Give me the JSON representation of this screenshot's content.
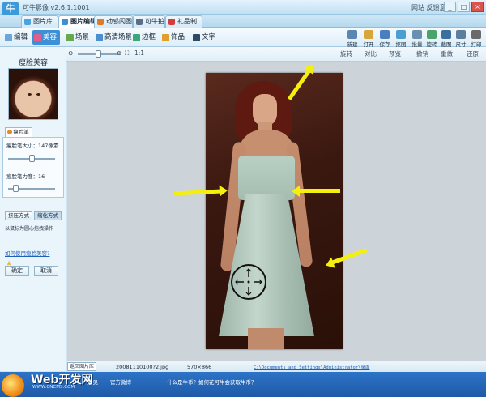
{
  "app": {
    "logo": "牛",
    "title": "可牛影像 v2.6.1.1001",
    "links": "网站  反馈意见",
    "win_min": "_",
    "win_max": "□",
    "win_close": "×"
  },
  "tabs": [
    {
      "label": "图片库",
      "color": "#4aa3e0"
    },
    {
      "label": "图片编辑",
      "color": "#3b8fd2",
      "active": true
    },
    {
      "label": "动感闪图",
      "color": "#e07a2b"
    },
    {
      "label": "可牛拍照",
      "color": "#5a6f86"
    },
    {
      "label": "礼品制作",
      "color": "#d63b3b"
    }
  ],
  "toolbar": {
    "left": [
      {
        "label": "编辑",
        "icon": "edit-icon",
        "color": "#6aa7d8"
      },
      {
        "label": "美容",
        "icon": "beauty-icon",
        "color": "#e05f8c",
        "active": true
      },
      {
        "label": "场景",
        "icon": "scene-icon",
        "color": "#66a84b"
      },
      {
        "label": "高清场景",
        "icon": "hd-scene-icon",
        "color": "#4b8fd0"
      },
      {
        "label": "边框",
        "icon": "frame-icon",
        "color": "#3aa879"
      },
      {
        "label": "饰品",
        "icon": "accessory-icon",
        "color": "#e0a02b"
      },
      {
        "label": "文字",
        "icon": "text-icon",
        "color": "#2f4a66"
      }
    ],
    "right": [
      {
        "label": "新建",
        "icon": "new-icon",
        "color": "#5a87b0"
      },
      {
        "label": "打开",
        "icon": "open-icon",
        "color": "#d9a53a"
      },
      {
        "label": "保存",
        "icon": "save-icon",
        "color": "#4a7fbf"
      },
      {
        "label": "抠图",
        "icon": "cutout-icon",
        "color": "#4a9fd0"
      },
      {
        "label": "批量",
        "icon": "batch-icon",
        "color": "#6a8fb0"
      },
      {
        "label": "旋转",
        "icon": "rotate-icon",
        "color": "#4aa36a"
      },
      {
        "label": "截图",
        "icon": "screenshot-icon",
        "color": "#3a6fa0"
      },
      {
        "label": "尺寸",
        "icon": "size-icon",
        "color": "#5a7f9f"
      },
      {
        "label": "打印",
        "icon": "print-icon",
        "color": "#6a6a6a"
      }
    ]
  },
  "viewbar": {
    "ratio": "1:1",
    "items": [
      "旋转",
      "对比",
      "预览",
      "撤销",
      "重做",
      "还原"
    ]
  },
  "side": {
    "title": "瘦脸美容",
    "subtab": "瘦脸笔",
    "size_label": "瘦脸笔大小：147像素",
    "size_level": 0.5,
    "strength_label": "瘦脸笔力度：16",
    "strength_level": 0.16,
    "mode_push": "挤压方式",
    "mode_shrink": "缩化方式",
    "note": "以鼠标为圆心拖拽操作",
    "help": "如何使用瘦脸美容?",
    "ok": "确定",
    "cancel": "取消"
  },
  "status": {
    "button": "返回图片库",
    "filename": "20081110100?2.jpg",
    "dims": "570×866",
    "path": "C:\\Documents and Settings\\Administrator\\桌面"
  },
  "bottom": {
    "web_logo": "Web开发网",
    "web_url": "WWW.CNCMS.COM",
    "feedback": "意见",
    "community": "官方微博",
    "tip": "什么是牛币？如何花可牛会获取牛币？"
  }
}
